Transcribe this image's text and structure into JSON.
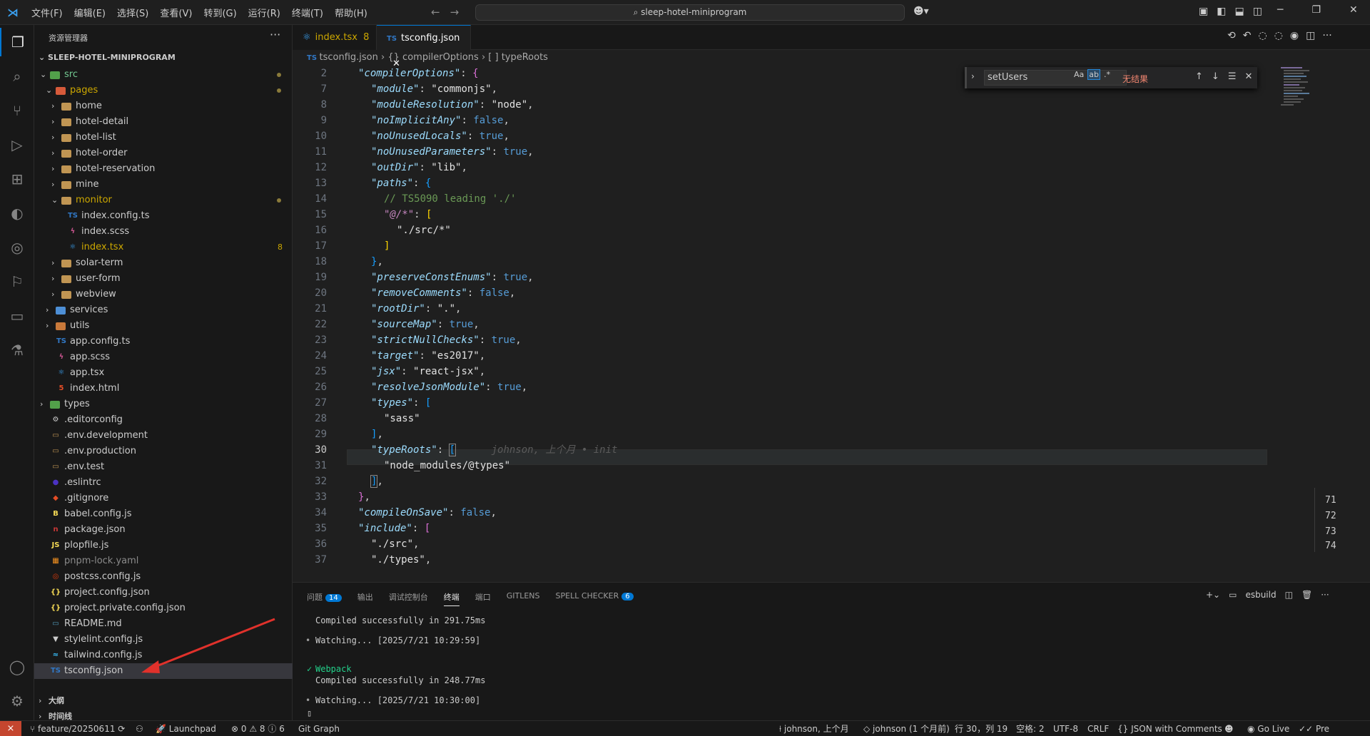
{
  "titlebar": {
    "menu": [
      "文件(F)",
      "编辑(E)",
      "选择(S)",
      "查看(V)",
      "转到(G)",
      "运行(R)",
      "终端(T)",
      "帮助(H)"
    ],
    "search": "sleep-hotel-miniprogram"
  },
  "sidebar": {
    "title": "资源管理器",
    "project": "SLEEP-HOTEL-MINIPROGRAM",
    "tree": [
      {
        "label": "src",
        "type": "folder",
        "depth": 1,
        "open": true,
        "color": "green",
        "modified": true
      },
      {
        "label": "pages",
        "type": "folder",
        "depth": 2,
        "open": true,
        "color": "red",
        "modified": true,
        "highlight": true
      },
      {
        "label": "home",
        "type": "folder",
        "depth": 3,
        "open": false
      },
      {
        "label": "hotel-detail",
        "type": "folder",
        "depth": 3,
        "open": false
      },
      {
        "label": "hotel-list",
        "type": "folder",
        "depth": 3,
        "open": false
      },
      {
        "label": "hotel-order",
        "type": "folder",
        "depth": 3,
        "open": false
      },
      {
        "label": "hotel-reservation",
        "type": "folder",
        "depth": 3,
        "open": false
      },
      {
        "label": "mine",
        "type": "folder",
        "depth": 3,
        "open": false
      },
      {
        "label": "monitor",
        "type": "folder",
        "depth": 3,
        "open": true,
        "modified": true,
        "highlight": true
      },
      {
        "label": "index.config.ts",
        "type": "ts",
        "depth": 4
      },
      {
        "label": "index.scss",
        "type": "scss",
        "depth": 4
      },
      {
        "label": "index.tsx",
        "type": "tsx",
        "depth": 4,
        "badge": "8",
        "highlight": true
      },
      {
        "label": "solar-term",
        "type": "folder",
        "depth": 3,
        "open": false
      },
      {
        "label": "user-form",
        "type": "folder",
        "depth": 3,
        "open": false
      },
      {
        "label": "webview",
        "type": "folder",
        "depth": 3,
        "open": false
      },
      {
        "label": "services",
        "type": "folder",
        "depth": 2,
        "open": false,
        "color": "blue"
      },
      {
        "label": "utils",
        "type": "folder",
        "depth": 2,
        "open": false,
        "color": "orange"
      },
      {
        "label": "app.config.ts",
        "type": "ts",
        "depth": 2
      },
      {
        "label": "app.scss",
        "type": "scss",
        "depth": 2
      },
      {
        "label": "app.tsx",
        "type": "tsx",
        "depth": 2
      },
      {
        "label": "index.html",
        "type": "html",
        "depth": 2
      },
      {
        "label": "types",
        "type": "folder",
        "depth": 1,
        "open": false,
        "color": "green"
      },
      {
        "label": ".editorconfig",
        "type": "cfg",
        "depth": 1
      },
      {
        "label": ".env.development",
        "type": "env",
        "depth": 1
      },
      {
        "label": ".env.production",
        "type": "env",
        "depth": 1
      },
      {
        "label": ".env.test",
        "type": "env",
        "depth": 1
      },
      {
        "label": ".eslintrc",
        "type": "eslint",
        "depth": 1
      },
      {
        "label": ".gitignore",
        "type": "git",
        "depth": 1
      },
      {
        "label": "babel.config.js",
        "type": "babel",
        "depth": 1
      },
      {
        "label": "package.json",
        "type": "npm",
        "depth": 1
      },
      {
        "label": "plopfile.js",
        "type": "js",
        "depth": 1
      },
      {
        "label": "pnpm-lock.yaml",
        "type": "yaml",
        "depth": 1,
        "dim": true
      },
      {
        "label": "postcss.config.js",
        "type": "postcss",
        "depth": 1
      },
      {
        "label": "project.config.json",
        "type": "json",
        "depth": 1
      },
      {
        "label": "project.private.config.json",
        "type": "json",
        "depth": 1
      },
      {
        "label": "README.md",
        "type": "md",
        "depth": 1
      },
      {
        "label": "stylelint.config.js",
        "type": "stylelint",
        "depth": 1
      },
      {
        "label": "tailwind.config.js",
        "type": "tailwind",
        "depth": 1
      },
      {
        "label": "tsconfig.json",
        "type": "tsconfig",
        "depth": 1,
        "selected": true
      }
    ],
    "outline": "大纲",
    "timeline": "时间线"
  },
  "tabs": [
    {
      "label": "index.tsx",
      "badge": "8",
      "active": false
    },
    {
      "label": "tsconfig.json",
      "active": true
    }
  ],
  "breadcrumb": [
    "tsconfig.json",
    "{} compilerOptions",
    "[ ] typeRoots"
  ],
  "find": {
    "value": "setUsers",
    "opt_case": "Aa",
    "opt_word": "ab",
    "opt_regex": ".*",
    "result": "无结果"
  },
  "blame": "johnson, 上个月 • init",
  "panel": {
    "tabs": [
      {
        "label": "问题",
        "badge": "14"
      },
      {
        "label": "输出"
      },
      {
        "label": "调试控制台"
      },
      {
        "label": "终端",
        "active": true
      },
      {
        "label": "端口"
      },
      {
        "label": "GITLENS"
      },
      {
        "label": "SPELL CHECKER",
        "badge": "6"
      }
    ],
    "terminal_name": "esbuild",
    "terminal": {
      "line1": "Compiled successfully in 291.75ms",
      "line2": "Watching... [2025/7/21 10:29:59]",
      "line3": "Webpack",
      "line4": "Compiled successfully in 248.77ms",
      "line5": "Watching... [2025/7/21 10:30:00]"
    },
    "gutter": [
      "71",
      "72",
      "73",
      "74"
    ]
  },
  "statusbar": {
    "branch": "feature/20250611",
    "launchpad": "Launchpad",
    "problems": "0",
    "warnings": "8",
    "info": "6",
    "gitgraph": "Git Graph",
    "blame": "johnson, 上个月",
    "author": "johnson (1 个月前)",
    "position": "行 30，列 19",
    "spaces": "空格: 2",
    "encoding": "UTF-8",
    "eol": "CRLF",
    "language": "JSON with Comments",
    "golive": "Go Live",
    "prettier": "Pre"
  },
  "colors": {
    "accent": "#0078d4",
    "remote": "#c5462f",
    "error_text": "#f48771"
  }
}
